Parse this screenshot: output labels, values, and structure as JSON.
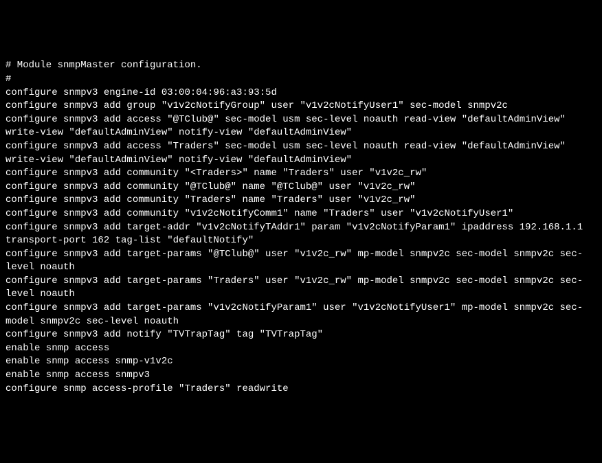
{
  "terminal": {
    "lines": [
      "# Module snmpMaster configuration.",
      "#",
      "configure snmpv3 engine-id 03:00:04:96:a3:93:5d",
      "configure snmpv3 add group \"v1v2cNotifyGroup\" user \"v1v2cNotifyUser1\" sec-model snmpv2c",
      "configure snmpv3 add access \"@TClub@\" sec-model usm sec-level noauth read-view \"defaultAdminView\" write-view \"defaultAdminView\" notify-view \"defaultAdminView\"",
      "configure snmpv3 add access \"Traders\" sec-model usm sec-level noauth read-view \"defaultAdminView\" write-view \"defaultAdminView\" notify-view \"defaultAdminView\"",
      "configure snmpv3 add community \"<Traders>\" name \"Traders\" user \"v1v2c_rw\"",
      "configure snmpv3 add community \"@TClub@\" name \"@TClub@\" user \"v1v2c_rw\"",
      "configure snmpv3 add community \"Traders\" name \"Traders\" user \"v1v2c_rw\"",
      "configure snmpv3 add community \"v1v2cNotifyComm1\" name \"Traders\" user \"v1v2cNotifyUser1\"",
      "configure snmpv3 add target-addr \"v1v2cNotifyTAddr1\" param \"v1v2cNotifyParam1\" ipaddress 192.168.1.1 transport-port 162 tag-list \"defaultNotify\"",
      "configure snmpv3 add target-params \"@TClub@\" user \"v1v2c_rw\" mp-model snmpv2c sec-model snmpv2c sec-level noauth",
      "configure snmpv3 add target-params \"Traders\" user \"v1v2c_rw\" mp-model snmpv2c sec-model snmpv2c sec-level noauth",
      "configure snmpv3 add target-params \"v1v2cNotifyParam1\" user \"v1v2cNotifyUser1\" mp-model snmpv2c sec-model snmpv2c sec-level noauth",
      "configure snmpv3 add notify \"TVTrapTag\" tag \"TVTrapTag\"",
      "enable snmp access",
      "enable snmp access snmp-v1v2c",
      "enable snmp access snmpv3",
      "configure snmp access-profile \"Traders\" readwrite"
    ]
  }
}
